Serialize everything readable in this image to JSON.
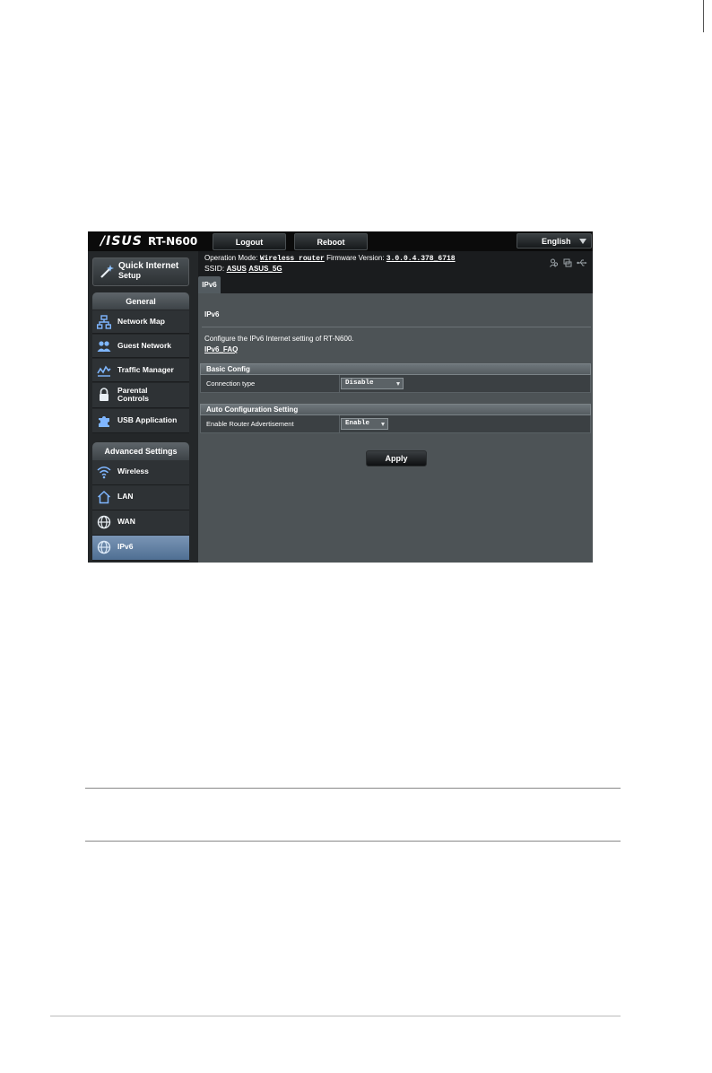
{
  "header": {
    "brand": "/ISUS",
    "model": "RT-N600",
    "logout_label": "Logout",
    "reboot_label": "Reboot",
    "language": "English"
  },
  "sidebar": {
    "quick_setup": {
      "line1": "Quick Internet",
      "line2": "Setup"
    },
    "general_title": "General",
    "general_items": [
      {
        "label": "Network Map",
        "icon": "network-map-icon"
      },
      {
        "label": "Guest Network",
        "icon": "guest-network-icon"
      },
      {
        "label": "Traffic Manager",
        "icon": "traffic-manager-icon"
      },
      {
        "label1": "Parental",
        "label2": "Controls",
        "icon": "lock-icon"
      },
      {
        "label": "USB Application",
        "icon": "puzzle-icon"
      }
    ],
    "advanced_title": "Advanced Settings",
    "advanced_items": [
      {
        "label": "Wireless",
        "icon": "wifi-icon"
      },
      {
        "label": "LAN",
        "icon": "home-icon"
      },
      {
        "label": "WAN",
        "icon": "globe-icon"
      },
      {
        "label": "IPv6",
        "icon": "ipv6-globe-icon",
        "active": true
      }
    ]
  },
  "status": {
    "op_mode_label": "Operation Mode:",
    "op_mode_value": "Wireless router",
    "firmware_label": "Firmware Version:",
    "firmware_value": "3.0.0.4.378_6718",
    "ssid_label": "SSID:",
    "ssid_1": "ASUS",
    "ssid_2": "ASUS_5G"
  },
  "content": {
    "tab_label": "IPv6",
    "title": "IPv6",
    "description": "Configure the IPv6 Internet setting of RT-N600.",
    "faq_link": "IPv6_FAQ",
    "basic_config": {
      "title": "Basic Config",
      "connection_type_label": "Connection type",
      "connection_type_value": "Disable"
    },
    "auto_config": {
      "title": "Auto Configuration Setting",
      "router_adv_label": "Enable Router Advertisement",
      "router_adv_value": "Enable"
    },
    "apply_label": "Apply"
  }
}
